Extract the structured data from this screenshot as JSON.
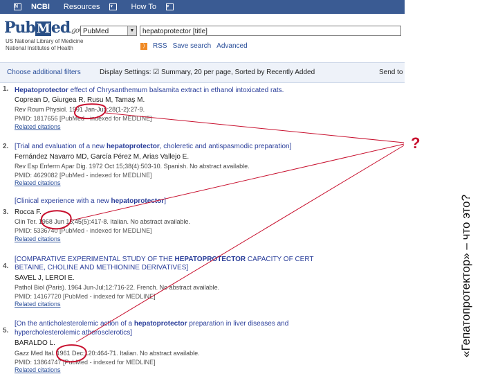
{
  "ncbi_bar": {
    "logo": "NCBI",
    "resources": "Resources",
    "howto": "How To"
  },
  "pubmed": {
    "logo_pub": "Pub",
    "logo_m": "M",
    "logo_ed": "ed",
    "logo_gov": ".gov",
    "nlm_line1": "US National Library of Medicine",
    "nlm_line2": "National Institutes of Health"
  },
  "search": {
    "database": "PubMed",
    "query": "hepatoprotector [title]",
    "rss": "RSS",
    "save_search": "Save search",
    "advanced": "Advanced"
  },
  "filterbar": {
    "filters": "Choose additional filters",
    "display": "Display Settings: ☑ Summary, 20 per page, Sorted by Recently Added",
    "send": "Send to"
  },
  "results": [
    {
      "num": "1.",
      "title_prefix": "",
      "title_bold": "Hepatoprotector",
      "title_suffix": " effect of Chrysanthemum balsamita extract in ethanol intoxicated rats.",
      "authors": "Coprean D, Giurgea R, Rusu M, Tamaş M.",
      "source": "Rev Roum Physiol. 1991 Jan-Jun;28(1-2):27-9.",
      "pmid": "PMID: 1817656 [PubMed - indexed for MEDLINE]",
      "related": "Related citations"
    },
    {
      "num": "2.",
      "title_prefix": "[Trial and evaluation of a new ",
      "title_bold": "hepatoprotector",
      "title_suffix": ", choleretic and antispasmodic preparation]",
      "authors": "Fernández Navarro MD, García Pérez M, Arias Vallejo E.",
      "source": "Rev Esp Enferm Apar Dig. 1972 Oct 15;38(4):503-10. Spanish. No abstract available.",
      "pmid": "PMID: 4629082 [PubMed - indexed for MEDLINE]",
      "related": "Related citations"
    },
    {
      "num": "3.",
      "title_prefix": "[Clinical experience with a new ",
      "title_bold": "hepatoprotector",
      "title_suffix": "]",
      "authors": "Rocca F.",
      "source": "Clin Ter. 1968 Jun 15;45(5):417-8. Italian. No abstract available.",
      "pmid": "PMID: 5336740 [PubMed - indexed for MEDLINE]",
      "related": "Related citations"
    },
    {
      "num": "4.",
      "title_prefix": "[COMPARATIVE EXPERIMENTAL STUDY OF THE ",
      "title_bold": "HEPATOPROTECTOR",
      "title_suffix": " CAPACITY OF CERT",
      "title_line2": "BETAINE, CHOLINE AND METHIONINE DERIVATIVES]",
      "authors": "SAVEL J, LEROI E.",
      "source": "Pathol Biol (Paris). 1964 Jun-Jul;12:716-22. French. No abstract available.",
      "pmid": "PMID: 14167720 [PubMed - indexed for MEDLINE]",
      "related": "Related citations"
    },
    {
      "num": "5.",
      "title_prefix": "[On the anticholesterolemic action of a ",
      "title_bold": "hepatoprotector",
      "title_suffix": " preparation in liver diseases and",
      "title_line2": "hypercholesterolemic atherosclerotics]",
      "authors": "BARALDO L.",
      "source": "Gazz Med Ital. 1961 Dec;120:464-71. Italian. No abstract available.",
      "pmid": "PMID: 13864747 [PubMed - indexed for MEDLINE]",
      "related": "Related citations"
    }
  ],
  "slide": {
    "title": "«Гепатопротектор» – что это?",
    "question_mark": "?"
  },
  "colors": {
    "ncbi_bar": "#3a5b93",
    "link": "#2a3e9a",
    "annotation": "#c8102e"
  }
}
